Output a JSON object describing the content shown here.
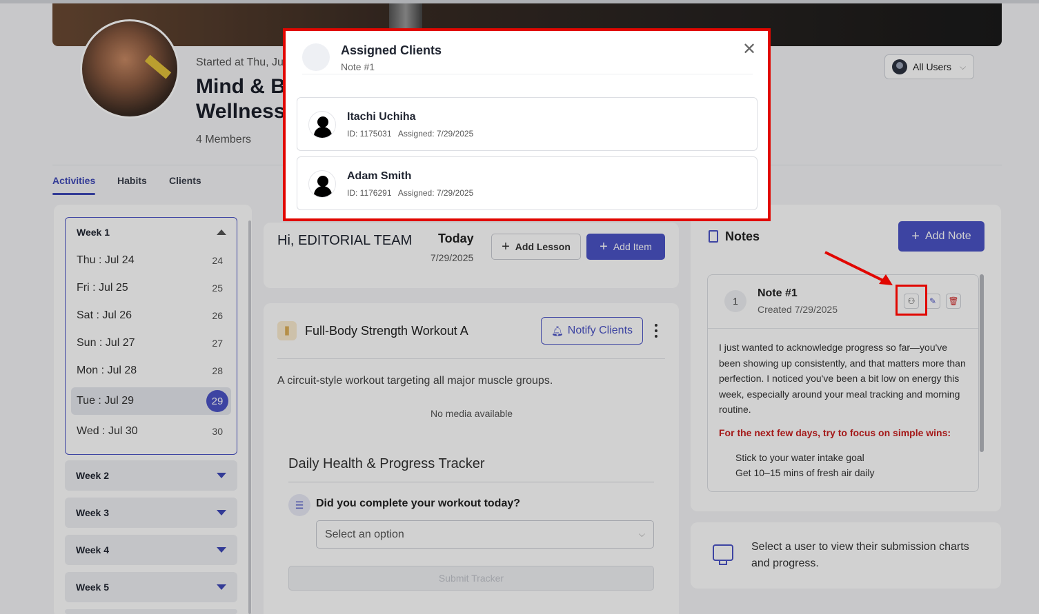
{
  "header": {
    "started_text": "Started at Thu, Ju",
    "title_line1": "Mind & B",
    "title_line2": "Wellness",
    "members": "4 Members",
    "user_filter": "All Users"
  },
  "tabs": [
    {
      "label": "Activities",
      "active": true
    },
    {
      "label": "Habits",
      "active": false
    },
    {
      "label": "Clients",
      "active": false
    }
  ],
  "weeks": {
    "expanded": {
      "label": "Week 1",
      "days": [
        {
          "label": "Thu : Jul 24",
          "num": "24"
        },
        {
          "label": "Fri : Jul 25",
          "num": "25"
        },
        {
          "label": "Sat : Jul 26",
          "num": "26"
        },
        {
          "label": "Sun : Jul 27",
          "num": "27"
        },
        {
          "label": "Mon : Jul 28",
          "num": "28"
        },
        {
          "label": "Tue : Jul 29",
          "num": "29",
          "selected": true
        },
        {
          "label": "Wed : Jul 30",
          "num": "30"
        }
      ]
    },
    "collapsed": [
      "Week 2",
      "Week 3",
      "Week 4",
      "Week 5"
    ]
  },
  "greeting": {
    "text": "Hi, EDITORIAL TEAM",
    "today_label": "Today",
    "today_date": "7/29/2025",
    "add_lesson": "Add Lesson",
    "add_item": "Add Item"
  },
  "workout": {
    "title": "Full-Body Strength Workout A",
    "notify_label": "Notify Clients",
    "description": "A circuit-style workout targeting all major muscle groups.",
    "no_media": "No media available",
    "tracker_title": "Daily Health & Progress Tracker",
    "question": "Did you complete your workout today?",
    "select_placeholder": "Select an option",
    "submit_label": "Submit Tracker"
  },
  "notes": {
    "title": "Notes",
    "add_label": "Add Note",
    "note": {
      "number": "1",
      "name": "Note #1",
      "created": "Created 7/29/2025",
      "body": "I just wanted to acknowledge progress so far—you've been showing up consistently, and that matters more than perfection. I noticed you've been a bit low on energy this week, especially around your meal tracking and morning routine.",
      "highlight": "For the next few days, try to focus on simple wins:",
      "items": [
        "Stick to your water intake goal",
        "Get 10–15 mins of fresh air daily"
      ]
    }
  },
  "chart_prompt": "Select a user to view their submission charts and progress.",
  "modal": {
    "title": "Assigned Clients",
    "subtitle": "Note #1",
    "clients": [
      {
        "name": "Itachi Uchiha",
        "id": "ID: 1175031",
        "assigned": "Assigned: 7/29/2025"
      },
      {
        "name": "Adam Smith",
        "id": "ID: 1176291",
        "assigned": "Assigned: 7/29/2025"
      }
    ]
  },
  "colors": {
    "accent": "#4b53c6",
    "highlight_red": "#c81e1e",
    "annotation_red": "#e10600"
  }
}
